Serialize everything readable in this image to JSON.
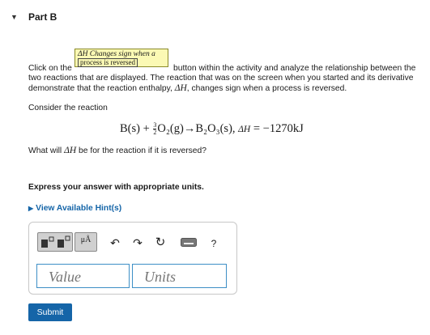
{
  "part": {
    "title": "Part B",
    "caret": "▼"
  },
  "intro": {
    "line1_before": "Click on the",
    "tip_button": {
      "line1": "ΔH Changes sign when a",
      "line2": "process is reversed"
    },
    "line1_after": "button within the activity and analyze the relationship between the",
    "line2": "two reactions that are displayed. The reaction that was on the screen when you started and its derivative",
    "line3_before": "demonstrate that the reaction enthalpy,",
    "line3_symbol": "ΔH",
    "line3_after": ", changes sign when a process is reversed."
  },
  "consider": "Consider the reaction",
  "equation": {
    "lhs1": "B(s) +",
    "frac_num": "3",
    "frac_den": "2",
    "lhs2": "O₂(g)→B₂O₃(s),",
    "dh_symbol": "ΔH",
    "dh_value": "= −1270kJ"
  },
  "question": {
    "before": "What will",
    "symbol": "ΔH",
    "after": "be for the reaction if it is reversed?"
  },
  "instruction": "Express your answer with appropriate units.",
  "hint": {
    "caret": "▶",
    "label": "View Available Hint(s)"
  },
  "toolbar": {
    "units_button_label": "μÅ",
    "undo_icon": "↶",
    "redo_icon": "↷",
    "reset_icon": "↻",
    "keyboard_icon": "▭",
    "help_label": "?"
  },
  "inputs": {
    "value_placeholder": "Value",
    "units_placeholder": "Units"
  },
  "submit_label": "Submit"
}
